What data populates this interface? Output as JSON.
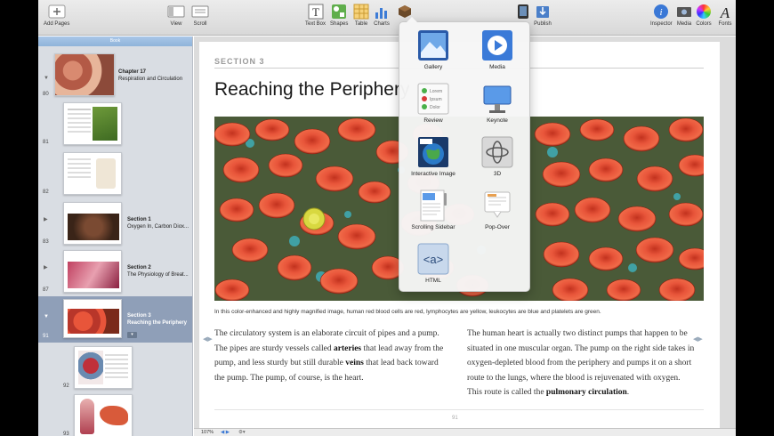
{
  "toolbar": {
    "add_pages": "Add Pages",
    "view": "View",
    "scroll": "Scroll",
    "text_box": "Text Box",
    "shapes": "Shapes",
    "table": "Table",
    "charts": "Charts",
    "publish": "Publish",
    "inspector": "Inspector",
    "media": "Media",
    "colors": "Colors",
    "fonts": "Fonts"
  },
  "sidebar": {
    "header": "Book",
    "items": [
      {
        "page": "80",
        "title": "Chapter 17",
        "subtitle": "Respiration and Circulation"
      },
      {
        "page": "81",
        "title": "",
        "subtitle": ""
      },
      {
        "page": "82",
        "title": "",
        "subtitle": ""
      },
      {
        "page": "83",
        "title": "Section 1",
        "subtitle": "Oxygen In, Carbon Diox..."
      },
      {
        "page": "87",
        "title": "Section 2",
        "subtitle": "The Physiology of Breat..."
      },
      {
        "page": "91",
        "title": "Section 3",
        "subtitle": "Reaching the Periphery"
      },
      {
        "page": "92",
        "title": "",
        "subtitle": ""
      },
      {
        "page": "93",
        "title": "",
        "subtitle": ""
      }
    ]
  },
  "page": {
    "section_label": "SECTION 3",
    "heading": "Reaching the Periphery",
    "caption": "In this color-enhanced and highly magnified image, human red blood cells are red, lymphocytes are yellow, leukocytes are blue and platelets are green.",
    "col_left": {
      "t1": "The circulatory system is an elaborate circuit of pipes and a pump. The pipes are sturdy vessels called ",
      "b1": "arteries",
      "t2": " that lead away from the pump, and less sturdy but still durable ",
      "b2": "veins",
      "t3": " that lead back toward the pump. The pump, of course, is the heart."
    },
    "col_right": {
      "t1": "The human heart is actually two distinct pumps that happen to be situated in one muscular organ. The pump on the right side takes in oxygen-depleted blood from the periphery and pumps it on a short route to the lungs, where the blood is rejuvenated with oxygen. This route is called the ",
      "b1": "pulmonary circulation",
      "t2": "."
    },
    "page_number": "91"
  },
  "status": {
    "zoom": "107%"
  },
  "popover": {
    "items": [
      {
        "label": "Gallery",
        "icon": "gallery-icon"
      },
      {
        "label": "Media",
        "icon": "media-play-icon"
      },
      {
        "label": "Review",
        "icon": "review-icon"
      },
      {
        "label": "Keynote",
        "icon": "keynote-icon"
      },
      {
        "label": "Interactive Image",
        "icon": "interactive-image-icon"
      },
      {
        "label": "3D",
        "icon": "3d-icon"
      },
      {
        "label": "Scrolling Sidebar",
        "icon": "scrolling-sidebar-icon"
      },
      {
        "label": "Pop-Over",
        "icon": "pop-over-icon"
      },
      {
        "label": "HTML",
        "icon": "html-icon"
      }
    ],
    "review_lines": [
      "Lorem",
      "Ipsum",
      "Dolor"
    ],
    "html_glyph": "<a>"
  }
}
